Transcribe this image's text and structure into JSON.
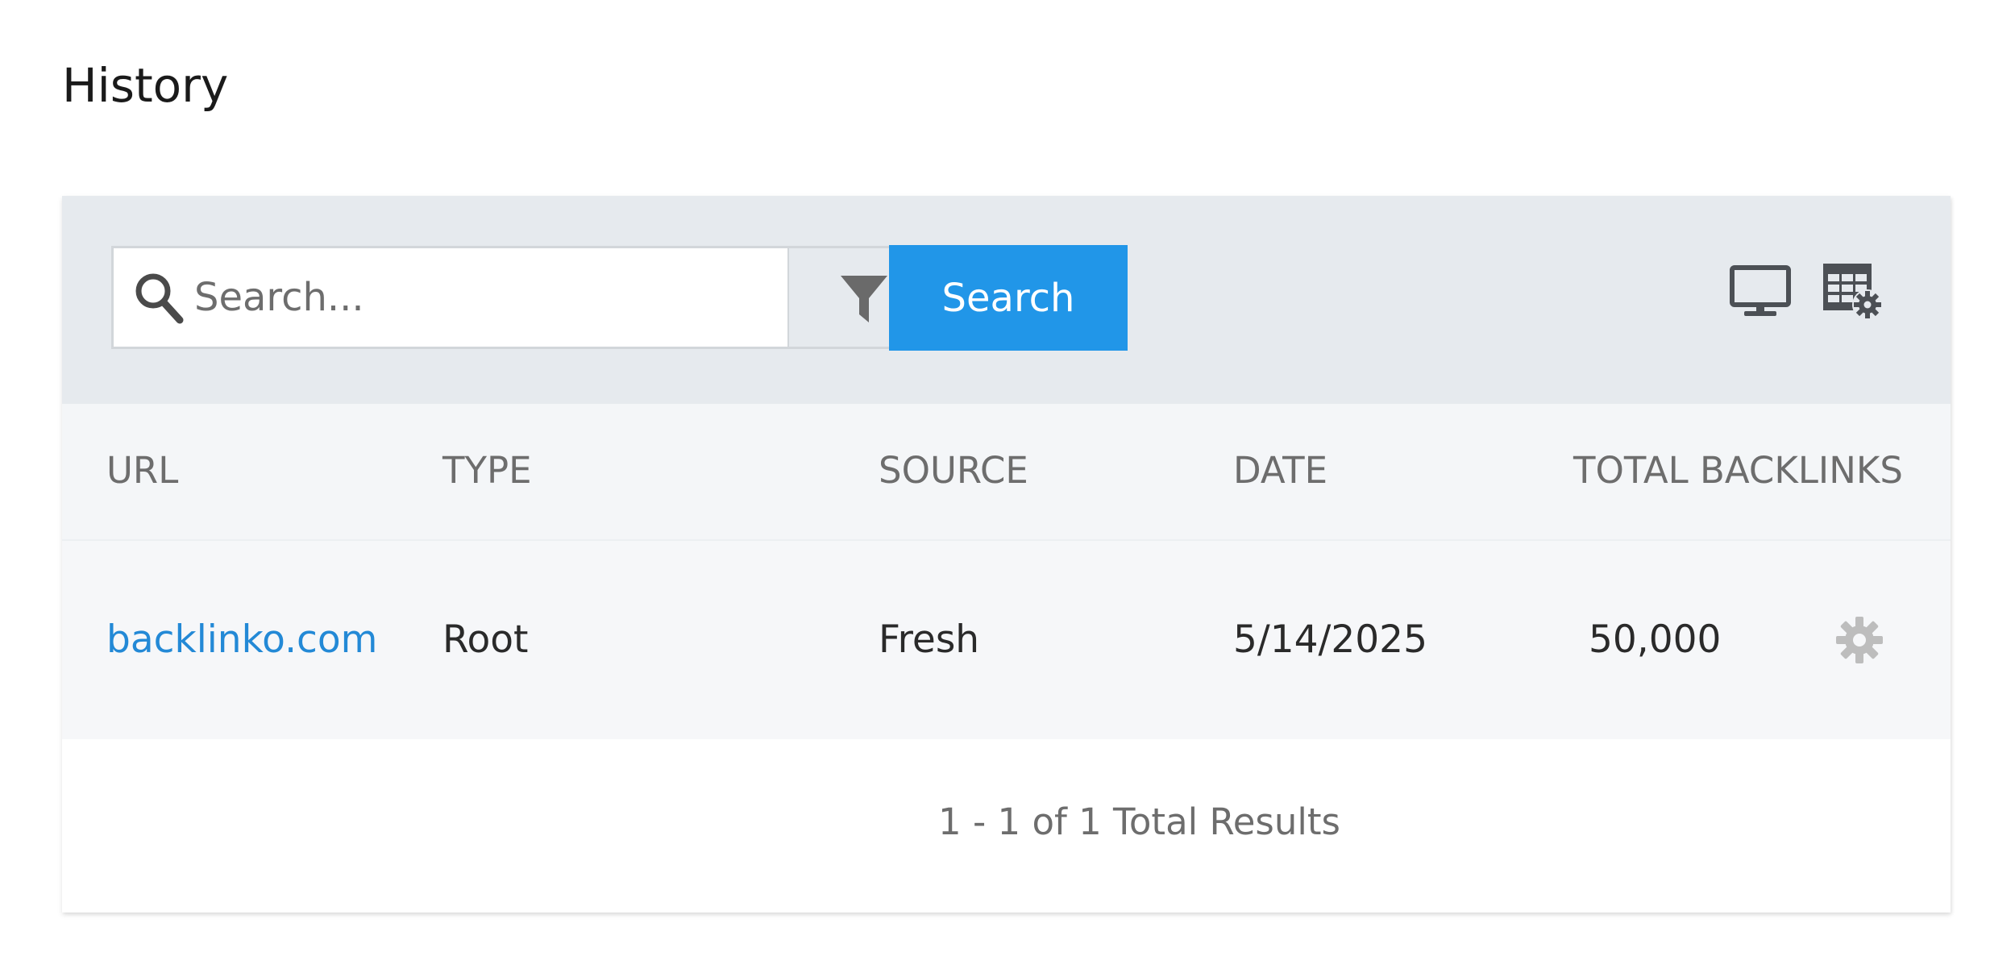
{
  "page": {
    "title": "History"
  },
  "toolbar": {
    "search_placeholder": "Search...",
    "search_value": "",
    "search_button_label": "Search"
  },
  "icons": {
    "search": "search-icon",
    "filter": "filter-icon",
    "view": "monitor-icon",
    "table_settings": "table-settings-icon",
    "row_actions": "gear-icon"
  },
  "colors": {
    "accent": "#2196e8",
    "link": "#2389d6",
    "toolbar_bg": "#e6eaee"
  },
  "table": {
    "columns": [
      "URL",
      "TYPE",
      "SOURCE",
      "DATE",
      "TOTAL BACKLINKS"
    ],
    "rows": [
      {
        "url": "backlinko.com",
        "type": "Root",
        "source": "Fresh",
        "date": "5/14/2025",
        "total_backlinks": "50,000"
      }
    ]
  },
  "pagination": {
    "summary": "1 - 1 of 1 Total Results"
  }
}
